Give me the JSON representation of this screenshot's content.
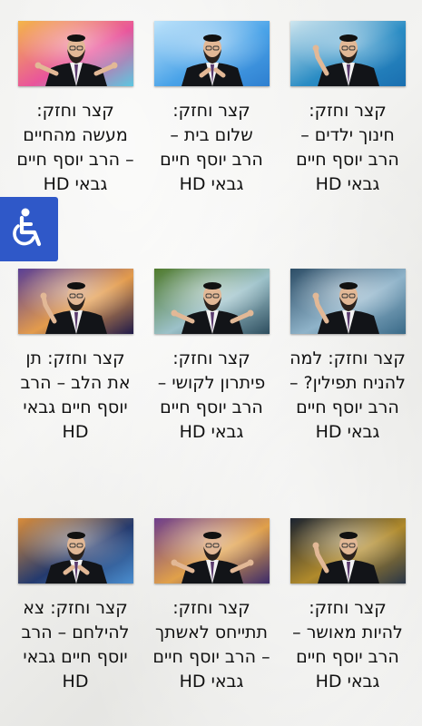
{
  "accessibility": {
    "icon": "wheelchair-icon",
    "color": "#2f58c8"
  },
  "videos": [
    {
      "title": "קצר וחזק: חינוך ילדים – הרב יוסף חיים גבאי HD",
      "bg": [
        "#cfe6ef",
        "#2a8cc4",
        "#1a6fb0"
      ],
      "pose": "point"
    },
    {
      "title": "קצר וחזק: שלום בית – הרב יוסף חיים גבאי HD",
      "bg": [
        "#bfe4fb",
        "#4aa3e8",
        "#2e7fd0"
      ],
      "pose": "center"
    },
    {
      "title": "קצר וחזק: מעשה מהחיים – הרב יוסף חיים גבאי HD",
      "bg": [
        "#f4b54a",
        "#e9559b",
        "#5cc7e0"
      ],
      "pose": "open"
    },
    {
      "title": "קצר וחזק: למה להניח תפילין? – הרב יוסף חיים גבאי HD",
      "bg": [
        "#2c4d66",
        "#8fb3c9",
        "#3a6a88"
      ],
      "pose": "point"
    },
    {
      "title": "קצר וחזק: פיתרון לקושי – הרב יוסף חיים גבאי HD",
      "bg": [
        "#4f7a2c",
        "#9cc1c9",
        "#2d4d5e"
      ],
      "pose": "open"
    },
    {
      "title": "קצר וחזק: תן את הלב – הרב יוסף חיים גבאי HD",
      "bg": [
        "#5a3f96",
        "#e39b4c",
        "#1f1a4a"
      ],
      "pose": "point"
    },
    {
      "title": "קצר וחזק: להיות מאושר – הרב יוסף חיים גבאי HD",
      "bg": [
        "#1b2330",
        "#b08a2c",
        "#2a3646"
      ],
      "pose": "point"
    },
    {
      "title": "קצר וחזק: תתייחס לאשתך – הרב יוסף חיים גבאי HD",
      "bg": [
        "#6e3e8c",
        "#e0a04a",
        "#3b2a6a"
      ],
      "pose": "open"
    },
    {
      "title": "קצר וחזק: צא להילחם – הרב יוסף חיים גבאי HD",
      "bg": [
        "#d98c3a",
        "#243a6e",
        "#4a8ed0"
      ],
      "pose": "center"
    }
  ]
}
